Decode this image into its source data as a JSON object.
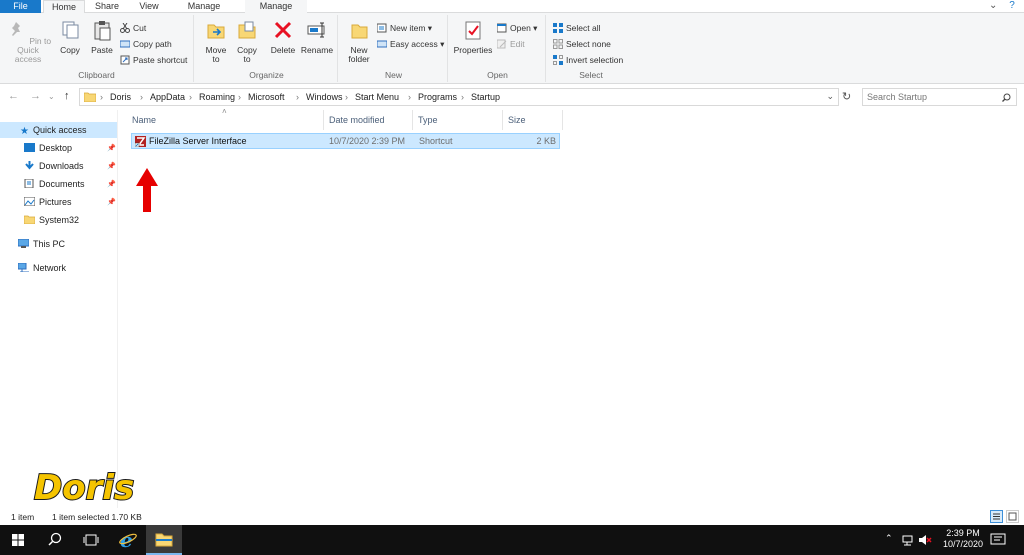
{
  "tabs": {
    "file": "File",
    "home": "Home",
    "share": "Share",
    "view": "View",
    "manage1": "Manage",
    "manage2": "Manage"
  },
  "ribbon": {
    "clipboard": {
      "pin": "Pin to Quick access",
      "copy": "Copy",
      "paste": "Paste",
      "cut": "Cut",
      "copy_path": "Copy path",
      "paste_shortcut": "Paste shortcut",
      "label": "Clipboard"
    },
    "organize": {
      "move_to": "Move to",
      "copy_to": "Copy to",
      "delete": "Delete",
      "rename": "Rename",
      "label": "Organize"
    },
    "new": {
      "new_folder": "New folder",
      "new_item": "New item",
      "easy_access": "Easy access",
      "label": "New"
    },
    "open": {
      "properties": "Properties",
      "open": "Open",
      "edit": "Edit",
      "label": "Open"
    },
    "select": {
      "select_all": "Select all",
      "select_none": "Select none",
      "invert": "Invert selection",
      "label": "Select"
    }
  },
  "address": {
    "crumbs": [
      "Doris",
      "AppData",
      "Roaming",
      "Microsoft",
      "Windows",
      "Start Menu",
      "Programs",
      "Startup"
    ],
    "search_placeholder": "Search Startup"
  },
  "nav": {
    "quick_access": "Quick access",
    "items": [
      "Desktop",
      "Downloads",
      "Documents",
      "Pictures",
      "System32"
    ],
    "this_pc": "This PC",
    "network": "Network"
  },
  "columns": {
    "name": "Name",
    "date": "Date modified",
    "type": "Type",
    "size": "Size"
  },
  "files": [
    {
      "name": "FileZilla Server Interface",
      "date": "10/7/2020 2:39 PM",
      "type": "Shortcut",
      "size": "2 KB"
    }
  ],
  "status": {
    "count": "1 item",
    "selected": "1 item selected  1.70 KB"
  },
  "logo_text": "Doris",
  "clock": {
    "time": "2:39 PM",
    "date": "10/7/2020"
  },
  "colors": {
    "accent": "#1979ca",
    "selection": "#cce8ff",
    "arrow": "#e60000",
    "logo": "#f5c400"
  }
}
